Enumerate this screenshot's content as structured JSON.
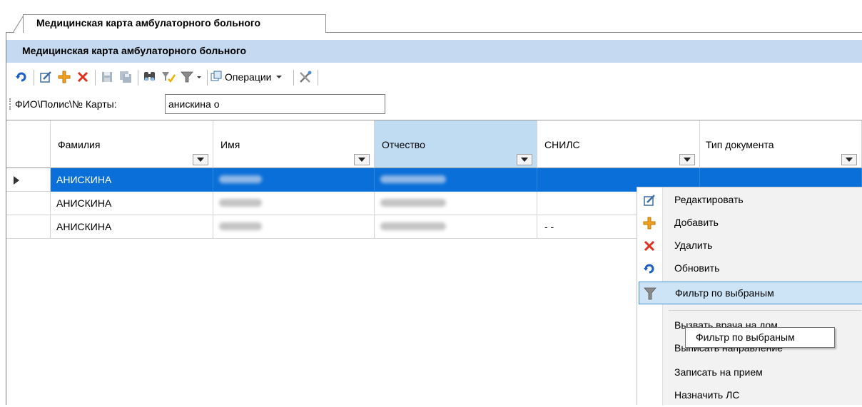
{
  "tab": {
    "title": "Медицинская карта амбулаторного больного"
  },
  "header": {
    "title": "Медицинская карта амбулаторного больного"
  },
  "toolbar": {
    "operations_label": "Операции",
    "icons": [
      "refresh-icon",
      "edit-icon",
      "add-icon",
      "delete-icon",
      "save-icon",
      "save-all-icon",
      "find-icon",
      "filter-selected-icon",
      "filter-icon",
      "operations-icon",
      "tools-icon"
    ]
  },
  "search": {
    "label": "ФИО\\Полис\\№ Карты:",
    "value": "анискина о"
  },
  "grid": {
    "columns": [
      "Фамилия",
      "Имя",
      "Отчество",
      "СНИЛС",
      "Тип документа"
    ],
    "rows": [
      {
        "surname": "АНИСКИНА",
        "snils": "",
        "selected": true
      },
      {
        "surname": "АНИСКИНА",
        "snils": ""
      },
      {
        "surname": "АНИСКИНА",
        "snils": "- -"
      }
    ]
  },
  "context_menu": {
    "items": [
      {
        "label": "Редактировать",
        "icon": "edit-icon"
      },
      {
        "label": "Добавить",
        "icon": "add-icon"
      },
      {
        "label": "Удалить",
        "icon": "delete-icon"
      },
      {
        "label": "Обновить",
        "icon": "refresh-icon"
      },
      {
        "label": "Фильтр по выбраным",
        "icon": "filter-icon",
        "hover": true
      },
      {
        "label": "Вызвать врача на дом"
      },
      {
        "label": "Выписать направление"
      },
      {
        "label": "Записать на прием"
      },
      {
        "label": "Назначить ЛС"
      }
    ]
  },
  "tooltip": {
    "text": "Фильтр по выбраным"
  },
  "colors": {
    "selection": "#0a6fd8",
    "header_band": "#c5daf1",
    "menu_hover": "#cde4f7",
    "delete_red": "#e0301e",
    "add_orange": "#f0a020",
    "refresh_blue": "#1a5fc8"
  }
}
